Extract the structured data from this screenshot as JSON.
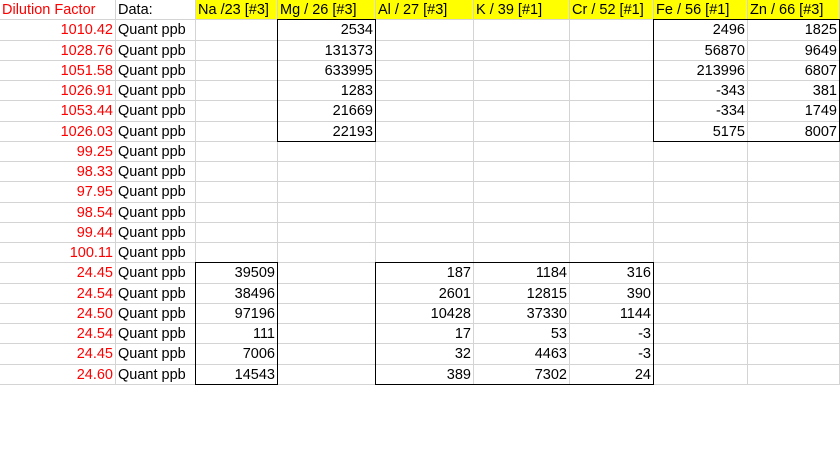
{
  "header": {
    "dilution_label": "Dilution Factor",
    "data_label": "Data:",
    "columns": [
      "Na /23 [#3]",
      "Mg /  26 [#3]",
      "Al /  27 [#3]",
      "K /  39 [#1]",
      "Cr /  52 [#1]",
      "Fe /  56 [#1]",
      "Zn /  66 [#3]",
      ""
    ]
  },
  "colors": {
    "dilution_text": "#ff0000",
    "header_fill": "#ffff00",
    "gridline": "#d4d4d4",
    "box_border": "#000000"
  },
  "rows": [
    {
      "dilution": "1010.42",
      "data": "Quant ppb",
      "values": [
        "",
        "2534",
        "",
        "",
        "",
        "2496",
        "1825",
        ""
      ]
    },
    {
      "dilution": "1028.76",
      "data": "Quant ppb",
      "values": [
        "",
        "131373",
        "",
        "",
        "",
        "56870",
        "9649",
        ""
      ]
    },
    {
      "dilution": "1051.58",
      "data": "Quant ppb",
      "values": [
        "",
        "633995",
        "",
        "",
        "",
        "213996",
        "6807",
        ""
      ]
    },
    {
      "dilution": "1026.91",
      "data": "Quant ppb",
      "values": [
        "",
        "1283",
        "",
        "",
        "",
        "-343",
        "381",
        ""
      ]
    },
    {
      "dilution": "1053.44",
      "data": "Quant ppb",
      "values": [
        "",
        "21669",
        "",
        "",
        "",
        "-334",
        "1749",
        ""
      ]
    },
    {
      "dilution": "1026.03",
      "data": "Quant ppb",
      "values": [
        "",
        "22193",
        "",
        "",
        "",
        "5175",
        "8007",
        ""
      ]
    },
    {
      "dilution": "99.25",
      "data": "Quant ppb",
      "values": [
        "",
        "",
        "",
        "",
        "",
        "",
        "",
        ""
      ]
    },
    {
      "dilution": "98.33",
      "data": "Quant ppb",
      "values": [
        "",
        "",
        "",
        "",
        "",
        "",
        "",
        ""
      ]
    },
    {
      "dilution": "97.95",
      "data": "Quant ppb",
      "values": [
        "",
        "",
        "",
        "",
        "",
        "",
        "",
        ""
      ]
    },
    {
      "dilution": "98.54",
      "data": "Quant ppb",
      "values": [
        "",
        "",
        "",
        "",
        "",
        "",
        "",
        ""
      ]
    },
    {
      "dilution": "99.44",
      "data": "Quant ppb",
      "values": [
        "",
        "",
        "",
        "",
        "",
        "",
        "",
        ""
      ]
    },
    {
      "dilution": "100.11",
      "data": "Quant ppb",
      "values": [
        "",
        "",
        "",
        "",
        "",
        "",
        "",
        ""
      ]
    },
    {
      "dilution": "24.45",
      "data": "Quant ppb",
      "values": [
        "39509",
        "",
        "187",
        "1184",
        "316",
        "",
        "",
        ""
      ]
    },
    {
      "dilution": "24.54",
      "data": "Quant ppb",
      "values": [
        "38496",
        "",
        "2601",
        "12815",
        "390",
        "",
        "",
        ""
      ]
    },
    {
      "dilution": "24.50",
      "data": "Quant ppb",
      "values": [
        "97196",
        "",
        "10428",
        "37330",
        "1144",
        "",
        "",
        ""
      ]
    },
    {
      "dilution": "24.54",
      "data": "Quant ppb",
      "values": [
        "111",
        "",
        "17",
        "53",
        "-3",
        "",
        "",
        ""
      ]
    },
    {
      "dilution": "24.45",
      "data": "Quant ppb",
      "values": [
        "7006",
        "",
        "32",
        "4463",
        "-3",
        "",
        "",
        ""
      ]
    },
    {
      "dilution": "24.60",
      "data": "Quant ppb",
      "values": [
        "14543",
        "",
        "389",
        "7302",
        "24",
        "",
        "",
        ""
      ]
    }
  ]
}
